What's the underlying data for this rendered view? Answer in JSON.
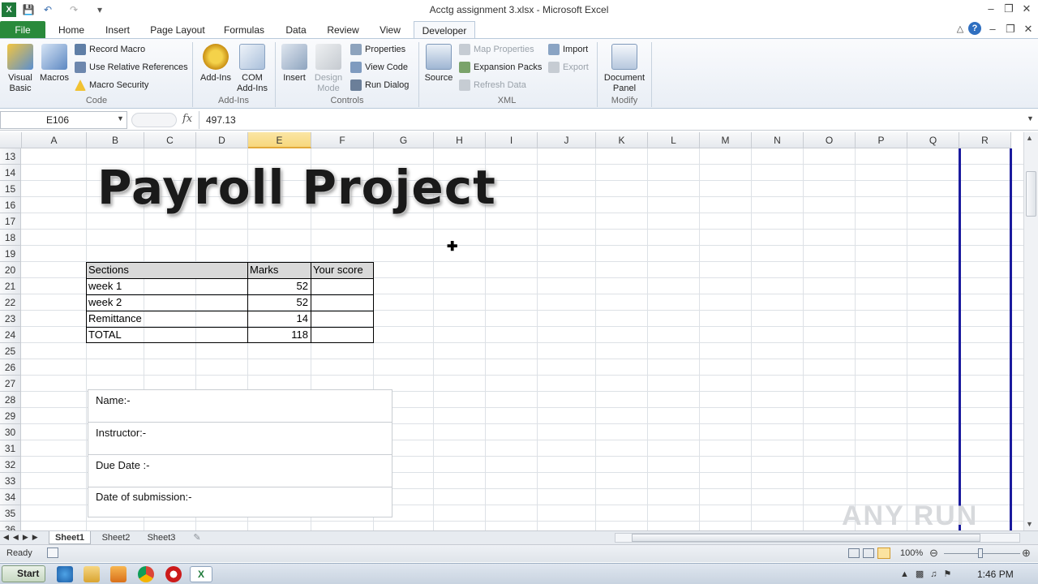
{
  "window": {
    "title": "Acctg assignment 3.xlsx - Microsoft Excel"
  },
  "ribbon_tabs": [
    "File",
    "Home",
    "Insert",
    "Page Layout",
    "Formulas",
    "Data",
    "Review",
    "View",
    "Developer"
  ],
  "active_tab": "Developer",
  "groups": {
    "code": {
      "label": "Code",
      "visual_basic": "Visual Basic",
      "macros": "Macros",
      "record_macro": "Record Macro",
      "use_relative": "Use Relative References",
      "macro_security": "Macro Security"
    },
    "addins": {
      "label": "Add-Ins",
      "addins": "Add-Ins",
      "com_addins": "COM Add-Ins"
    },
    "controls": {
      "label": "Controls",
      "insert": "Insert",
      "design_mode": "Design Mode",
      "properties": "Properties",
      "view_code": "View Code",
      "run_dialog": "Run Dialog"
    },
    "xml": {
      "label": "XML",
      "source": "Source",
      "map_properties": "Map Properties",
      "expansion_packs": "Expansion Packs",
      "refresh_data": "Refresh Data",
      "import": "Import",
      "export": "Export"
    },
    "modify": {
      "label": "Modify",
      "document_panel": "Document Panel"
    }
  },
  "formula_bar": {
    "name_box": "E106",
    "fx": "fx",
    "value": "497.13"
  },
  "columns": [
    "A",
    "B",
    "C",
    "D",
    "E",
    "F",
    "G",
    "H",
    "I",
    "J",
    "K",
    "L",
    "M",
    "N",
    "O",
    "P",
    "Q",
    "R"
  ],
  "selected_column": "E",
  "rows": [
    "13",
    "14",
    "15",
    "16",
    "17",
    "18",
    "19",
    "20",
    "21",
    "22",
    "23",
    "24",
    "25",
    "26",
    "27",
    "28",
    "29",
    "30",
    "31",
    "32",
    "33",
    "34",
    "35",
    "36"
  ],
  "sheet": {
    "title_art": "Payroll Project",
    "table_headers": [
      "Sections",
      "Marks",
      "Your score"
    ],
    "table_rows": [
      {
        "section": "week 1",
        "marks": "52",
        "score": ""
      },
      {
        "section": "week 2",
        "marks": "52",
        "score": ""
      },
      {
        "section": "Remittance",
        "marks": "14",
        "score": ""
      },
      {
        "section": "TOTAL",
        "marks": "118",
        "score": ""
      }
    ],
    "info_box": [
      "Name:-",
      "Instructor:-",
      "Due Date :-",
      "Date of submission:-"
    ]
  },
  "sheet_tabs": [
    "Sheet1",
    "Sheet2",
    "Sheet3"
  ],
  "active_sheet": "Sheet1",
  "status": {
    "ready": "Ready",
    "zoom": "100%"
  },
  "taskbar": {
    "start": "Start",
    "clock": "1:46 PM"
  },
  "watermark": "ANY RUN"
}
